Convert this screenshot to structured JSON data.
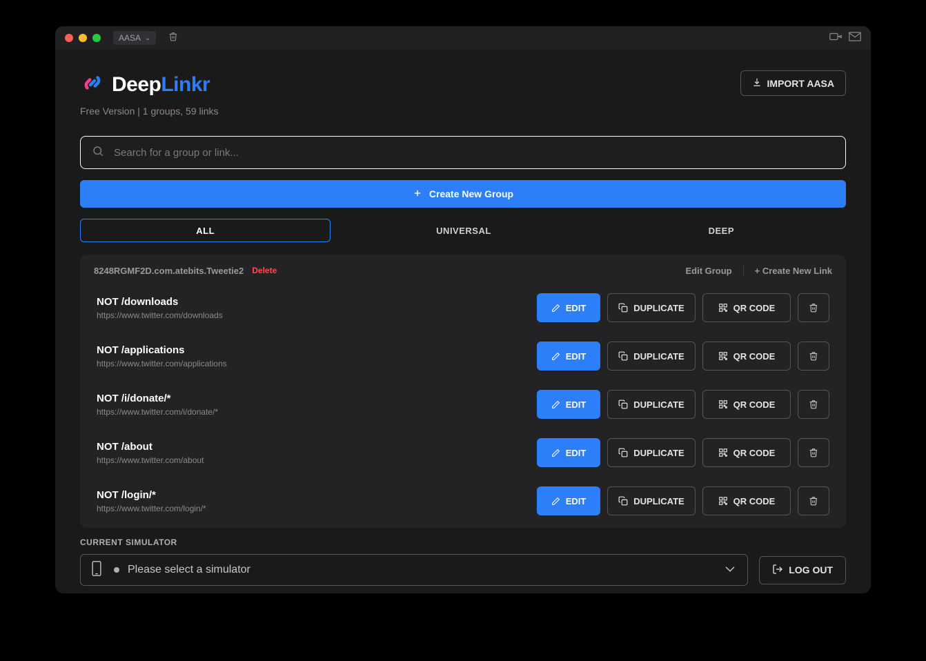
{
  "titlebar": {
    "menu_label": "AASA"
  },
  "header": {
    "brand_part1": "Deep",
    "brand_part2": "Linkr",
    "version_line": "Free Version | 1 groups, 59 links",
    "import_label": "IMPORT AASA"
  },
  "search": {
    "placeholder": "Search for a group or link..."
  },
  "create_group_label": "Create New Group",
  "tabs": [
    {
      "label": "ALL",
      "active": true
    },
    {
      "label": "UNIVERSAL",
      "active": false
    },
    {
      "label": "DEEP",
      "active": false
    }
  ],
  "group": {
    "id": "8248RGMF2D.com.atebits.Tweetie2",
    "delete_label": "Delete",
    "edit_group_label": "Edit Group",
    "create_link_label": "+ Create New Link",
    "links": [
      {
        "title": "NOT /downloads",
        "url": "https://www.twitter.com/downloads"
      },
      {
        "title": "NOT /applications",
        "url": "https://www.twitter.com/applications"
      },
      {
        "title": "NOT /i/donate/*",
        "url": "https://www.twitter.com/i/donate/*"
      },
      {
        "title": "NOT /about",
        "url": "https://www.twitter.com/about"
      },
      {
        "title": "NOT /login/*",
        "url": "https://www.twitter.com/login/*"
      }
    ],
    "buttons": {
      "edit": "EDIT",
      "duplicate": "DUPLICATE",
      "qr": "QR CODE"
    }
  },
  "simulator": {
    "label": "CURRENT SIMULATOR",
    "placeholder": "Please select a simulator"
  },
  "logout_label": "LOG OUT"
}
